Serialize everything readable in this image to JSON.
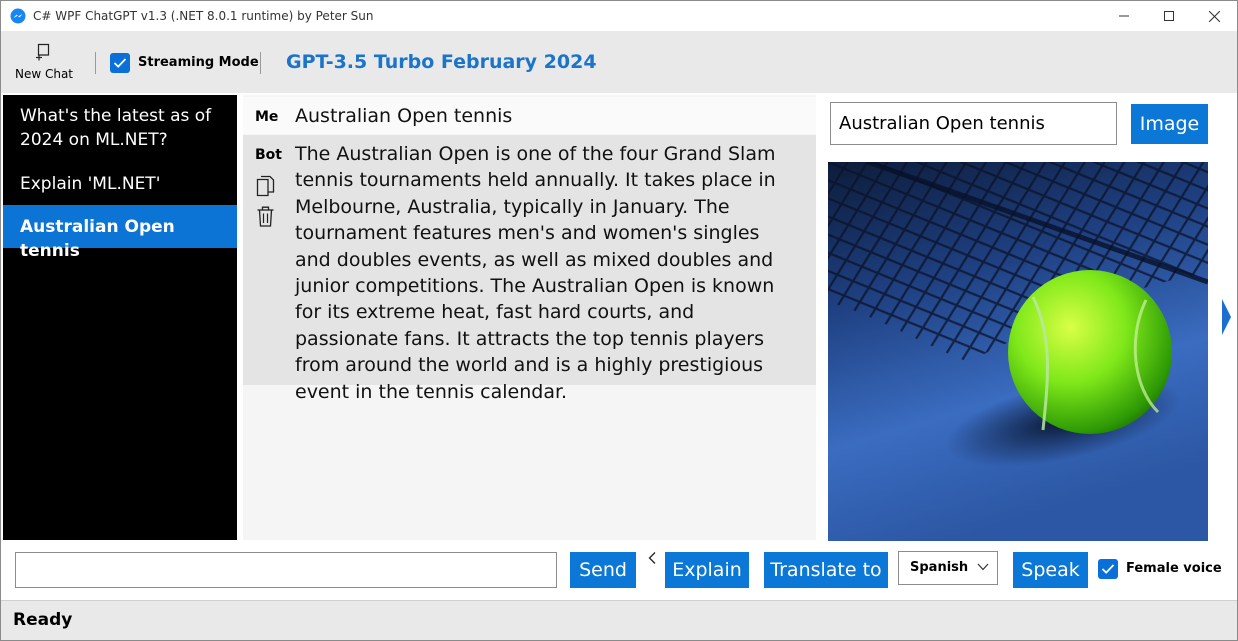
{
  "window": {
    "title": "C# WPF ChatGPT v1.3 (.NET 8.0.1 runtime) by Peter Sun",
    "app_icon": "messenger-icon"
  },
  "toolbar": {
    "new_chat_label": "New Chat",
    "streaming_label": "Streaming Mode",
    "streaming_checked": true,
    "model_title": "GPT-3.5 Turbo February 2024"
  },
  "sidebar": {
    "items": [
      {
        "label": "What's the latest as of 2024 on ML.NET?",
        "active": false
      },
      {
        "label": "Explain 'ML.NET'",
        "active": false
      },
      {
        "label": "Australian Open tennis",
        "active": true
      }
    ]
  },
  "chat": {
    "messages": [
      {
        "role": "Me",
        "text": "Australian Open tennis"
      },
      {
        "role": "Bot",
        "text": "The Australian Open is one of the four Grand Slam tennis tournaments held annually. It takes place in Melbourne, Australia, typically in January. The tournament features men's and women's singles and doubles events, as well as mixed doubles and junior competitions. The Australian Open is known for its extreme heat, fast hard courts, and passionate fans. It attracts the top tennis players from around the world and is a highly prestigious event in the tennis calendar."
      }
    ]
  },
  "image_panel": {
    "prompt_value": "Australian Open tennis",
    "image_button": "Image"
  },
  "bottom": {
    "input_value": "",
    "send": "Send",
    "explain": "Explain",
    "translate": "Translate to",
    "language": "Spanish",
    "speak": "Speak",
    "female_voice_label": "Female voice",
    "female_voice_checked": true
  },
  "status": {
    "text": "Ready"
  },
  "colors": {
    "accent": "#0b77d6",
    "model_title": "#1a74c9",
    "sidebar_bg": "#000000",
    "active_item": "#0b74d4"
  }
}
